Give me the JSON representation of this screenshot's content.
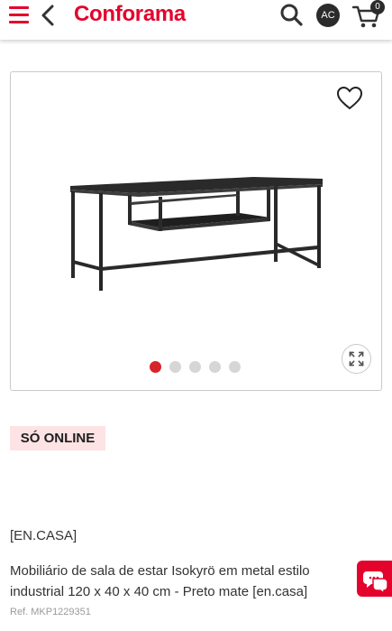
{
  "header": {
    "logo": "Conforama",
    "avatar_initials": "AC",
    "cart_count": "0",
    "icons": [
      "menu-icon",
      "back-chevron-icon",
      "search-icon",
      "cart-icon"
    ],
    "brand_color": "#e4032c"
  },
  "gallery": {
    "image_count": 5,
    "active_index": 0,
    "icons": [
      "heart-icon",
      "expand-icon"
    ]
  },
  "product": {
    "badge": "SÓ ONLINE",
    "brand": "[EN.CASA]",
    "title_line1": "Mobiliário de sala de estar Isokyrö em metal estilo",
    "title_line2": "industrial 120 x 40 x 40 cm - Preto mate [en.casa]",
    "ref": "Ref. MKP1229351"
  },
  "chat": {
    "icon": "chat-icon"
  }
}
